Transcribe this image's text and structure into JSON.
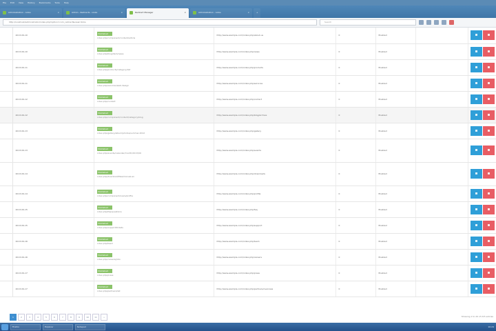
{
  "menubar": {
    "items": [
      "File",
      "Edit",
      "View",
      "History",
      "Bookmarks",
      "Tools",
      "Help"
    ]
  },
  "tabs": [
    {
      "label": "Administration - Links",
      "active": false
    },
    {
      "label": "Admin - Redirects - Links",
      "active": false
    },
    {
      "label": "Redirect Manager",
      "active": true
    },
    {
      "label": "Administration - Links",
      "active": false
    }
  ],
  "navbar": {
    "url": "http://localhost/administrator/index.php?option=com_redirect&view=links",
    "search": "Search"
  },
  "colors": {
    "edit": "#2f9fd8",
    "delete": "#e85d64",
    "badge": "#8bc36a"
  },
  "rows": [
    {
      "id": "1",
      "date": "2013-09-10",
      "badge": "Published",
      "old_url": "index.php/component/content/article",
      "new_url": "http://www.example.com/index.php/about-us",
      "hits": "0",
      "status": "Enabled",
      "tall": false,
      "hl": false
    },
    {
      "id": "2",
      "date": "2013-09-10",
      "badge": "Published",
      "old_url": "index.php/blog/item/news",
      "new_url": "http://www.example.com/index.php/news",
      "hits": "0",
      "status": "Enabled",
      "tall": false,
      "hl": false
    },
    {
      "id": "3",
      "date": "2013-09-11",
      "badge": "Published",
      "old_url": "index.php/products/category/list",
      "new_url": "http://www.example.com/index.php/products",
      "hits": "0",
      "status": "Enabled",
      "tall": false,
      "hl": false
    },
    {
      "id": "4",
      "date": "2013-09-11",
      "badge": "Published",
      "old_url": "index.php/services/web-design",
      "new_url": "http://www.example.com/index.php/services",
      "hits": "0",
      "status": "Enabled",
      "tall": false,
      "hl": false
    },
    {
      "id": "5",
      "date": "2013-09-12",
      "badge": "Published",
      "old_url": "index.php/contact",
      "new_url": "http://www.example.com/index.php/contact",
      "hits": "0",
      "status": "Enabled",
      "tall": false,
      "hl": false
    },
    {
      "id": "6",
      "date": "2013-09-12",
      "badge": "Published",
      "old_url": "index.php/component/content/category/blog",
      "new_url": "http://www.example.com/index.php/blog/archive",
      "hits": "0",
      "status": "Enabled",
      "tall": false,
      "hl": true
    },
    {
      "id": "7",
      "date": "2013-09-13",
      "badge": "Published",
      "old_url": "index.php/gallery/album/photos/summer-2012",
      "new_url": "http://www.example.com/index.php/gallery",
      "hits": "0",
      "status": "Enabled",
      "tall": false,
      "hl": false
    },
    {
      "id": "8",
      "date": "2013-09-13",
      "badge": "Published",
      "old_url": "index.php/events/calendar/month/2013/09",
      "new_url": "http://www.example.com/index.php/events",
      "hits": "0",
      "status": "Enabled",
      "tall": true,
      "hl": false
    },
    {
      "id": "9",
      "date": "2013-09-14",
      "badge": "Published",
      "old_url": "index.php/download/files/manual-en",
      "new_url": "http://www.example.com/index.php/downloads",
      "hits": "0",
      "status": "Enabled",
      "tall": true,
      "hl": false
    },
    {
      "id": "10",
      "date": "2013-09-14",
      "badge": "Published",
      "old_url": "index.php/component/users/profile",
      "new_url": "http://www.example.com/index.php/profile",
      "hits": "0",
      "status": "Enabled",
      "tall": false,
      "hl": false
    },
    {
      "id": "11",
      "date": "2013-09-15",
      "badge": "Published",
      "old_url": "index.php/faq/questions",
      "new_url": "http://www.example.com/index.php/faq",
      "hits": "0",
      "status": "Enabled",
      "tall": false,
      "hl": false
    },
    {
      "id": "12",
      "date": "2013-09-15",
      "badge": "Published",
      "old_url": "index.php/support/tickets",
      "new_url": "http://www.example.com/index.php/support",
      "hits": "0",
      "status": "Enabled",
      "tall": false,
      "hl": false
    },
    {
      "id": "13",
      "date": "2013-09-16",
      "badge": "Published",
      "old_url": "index.php/team",
      "new_url": "http://www.example.com/index.php/team",
      "hits": "0",
      "status": "Enabled",
      "tall": false,
      "hl": false
    },
    {
      "id": "14",
      "date": "2013-09-16",
      "badge": "Published",
      "old_url": "index.php/careers/jobs",
      "new_url": "http://www.example.com/index.php/careers",
      "hits": "0",
      "status": "Enabled",
      "tall": false,
      "hl": false
    },
    {
      "id": "15",
      "date": "2013-09-17",
      "badge": "Published",
      "old_url": "index.php/press",
      "new_url": "http://www.example.com/index.php/press",
      "hits": "0",
      "status": "Enabled",
      "tall": false,
      "hl": false
    },
    {
      "id": "16",
      "date": "2013-09-17",
      "badge": "Published",
      "old_url": "index.php/partners/list",
      "new_url": "http://www.example.com/index.php/partners/overview",
      "hits": "0",
      "status": "Enabled",
      "tall": false,
      "hl": false
    }
  ],
  "pagination": {
    "pages": [
      "1",
      "2",
      "3",
      "4",
      "5",
      "6",
      "7",
      "8",
      "9",
      "10",
      "11",
      "»"
    ],
    "active": "1",
    "info": "Showing 1 to 20 of 215 entries"
  },
  "taskbar": {
    "items": [
      "Firefox",
      "Explorer",
      "Notepad"
    ],
    "clock": "10:24"
  }
}
